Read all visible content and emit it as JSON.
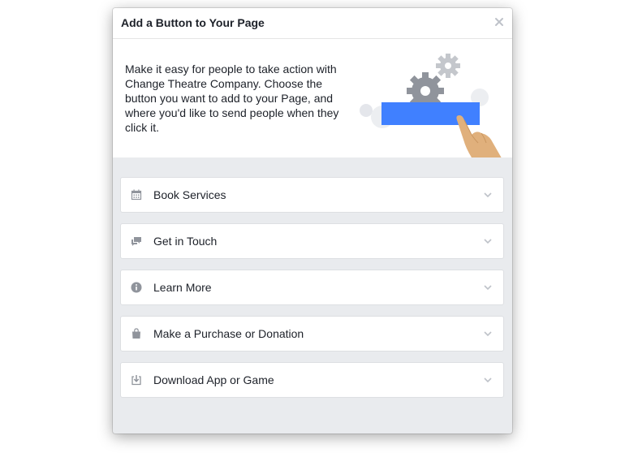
{
  "dialog": {
    "title": "Add a Button to Your Page",
    "close_icon": "close-icon"
  },
  "intro": {
    "text": "Make it easy for people to take action with Change Theatre Company. Choose the button you want to add to your Page, and where you'd like to send people when they click it.",
    "illustration_colors": {
      "button_blue": "#4080ff",
      "gear_gray": "#90949c",
      "hand_skin": "#e0b07c"
    }
  },
  "options": [
    {
      "label": "Book Services",
      "icon": "calendar-icon"
    },
    {
      "label": "Get in Touch",
      "icon": "chat-bubbles-icon"
    },
    {
      "label": "Learn More",
      "icon": "info-icon"
    },
    {
      "label": "Make a Purchase or Donation",
      "icon": "shopping-bag-icon"
    },
    {
      "label": "Download App or Game",
      "icon": "download-icon"
    }
  ],
  "colors": {
    "panel_background": "#e9ebee",
    "text": "#1d2129",
    "icon_gray": "#90949c"
  }
}
